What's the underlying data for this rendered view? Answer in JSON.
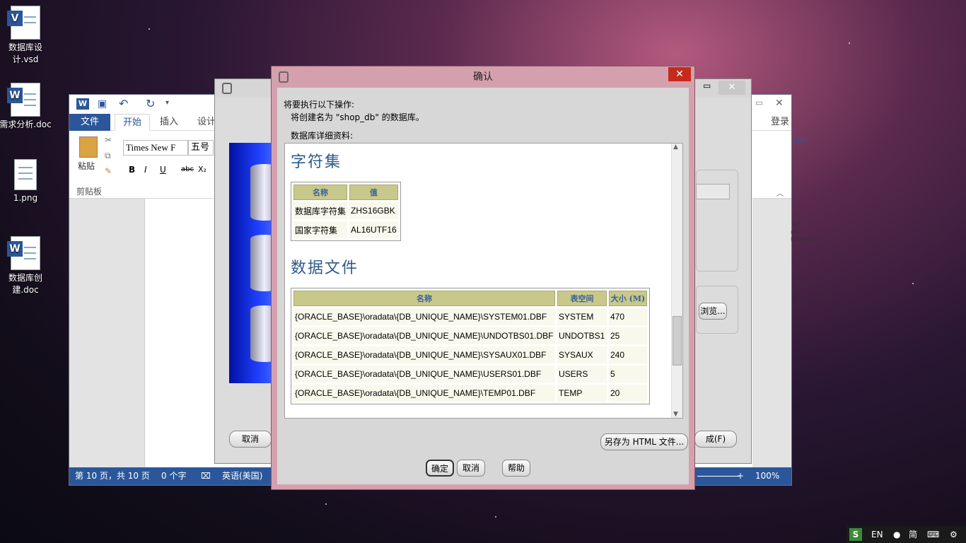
{
  "desktop": {
    "icons": [
      {
        "label": "数据库设计.vsd",
        "badge": "V"
      },
      {
        "label": "需求分析.doc",
        "badge": "W"
      },
      {
        "label": "1.png",
        "badge": ""
      },
      {
        "label": "数据库创建.doc",
        "badge": "W"
      }
    ]
  },
  "word": {
    "tabs": {
      "file": "文件",
      "home": "开始",
      "insert": "插入",
      "design": "设计"
    },
    "login": "登录",
    "paste": "粘贴",
    "clipboard": "剪贴板",
    "font_name": "Times New F",
    "font_size": "五号",
    "fmt": {
      "bold": "B",
      "italic": "I",
      "underline": "U",
      "strike": "abc",
      "sub": "X₂"
    },
    "status": {
      "page": "第 10 页，共 10 页",
      "words": "0 个字",
      "lang": "英语(美国)",
      "zoom": "100%"
    },
    "side_text1": "EEST",
    "side_text2": "W)",
    "side_text3": "nb (steady)"
  },
  "installer": {
    "cancel": "取消",
    "finish": "成(F)",
    "browse": "浏览..."
  },
  "dialog": {
    "title": "确认",
    "intro": "将要执行以下操作:",
    "create_msg": "将创建名为 \"shop_db\" 的数据库。",
    "details_label": "数据库详细资料:",
    "charset_heading": "字符集",
    "charset_table": {
      "headers": [
        "名称",
        "值"
      ],
      "rows": [
        [
          "数据库字符集",
          "ZHS16GBK"
        ],
        [
          "国家字符集",
          "AL16UTF16"
        ]
      ]
    },
    "datafiles_heading": "数据文件",
    "datafiles_table": {
      "headers": [
        "名称",
        "表空间",
        "大小 (M)"
      ],
      "rows": [
        [
          "{ORACLE_BASE}\\oradata\\{DB_UNIQUE_NAME}\\SYSTEM01.DBF",
          "SYSTEM",
          "470"
        ],
        [
          "{ORACLE_BASE}\\oradata\\{DB_UNIQUE_NAME}\\UNDOTBS01.DBF",
          "UNDOTBS1",
          "25"
        ],
        [
          "{ORACLE_BASE}\\oradata\\{DB_UNIQUE_NAME}\\SYSAUX01.DBF",
          "SYSAUX",
          "240"
        ],
        [
          "{ORACLE_BASE}\\oradata\\{DB_UNIQUE_NAME}\\USERS01.DBF",
          "USERS",
          "5"
        ],
        [
          "{ORACLE_BASE}\\oradata\\{DB_UNIQUE_NAME}\\TEMP01.DBF",
          "TEMP",
          "20"
        ]
      ]
    },
    "save_html": "另存为 HTML 文件...",
    "ok": "确定",
    "cancel": "取消",
    "help": "帮助",
    "close_glyph": "✕"
  },
  "taskbar": {
    "s": "S",
    "lang": "EN",
    "ime": "简"
  }
}
